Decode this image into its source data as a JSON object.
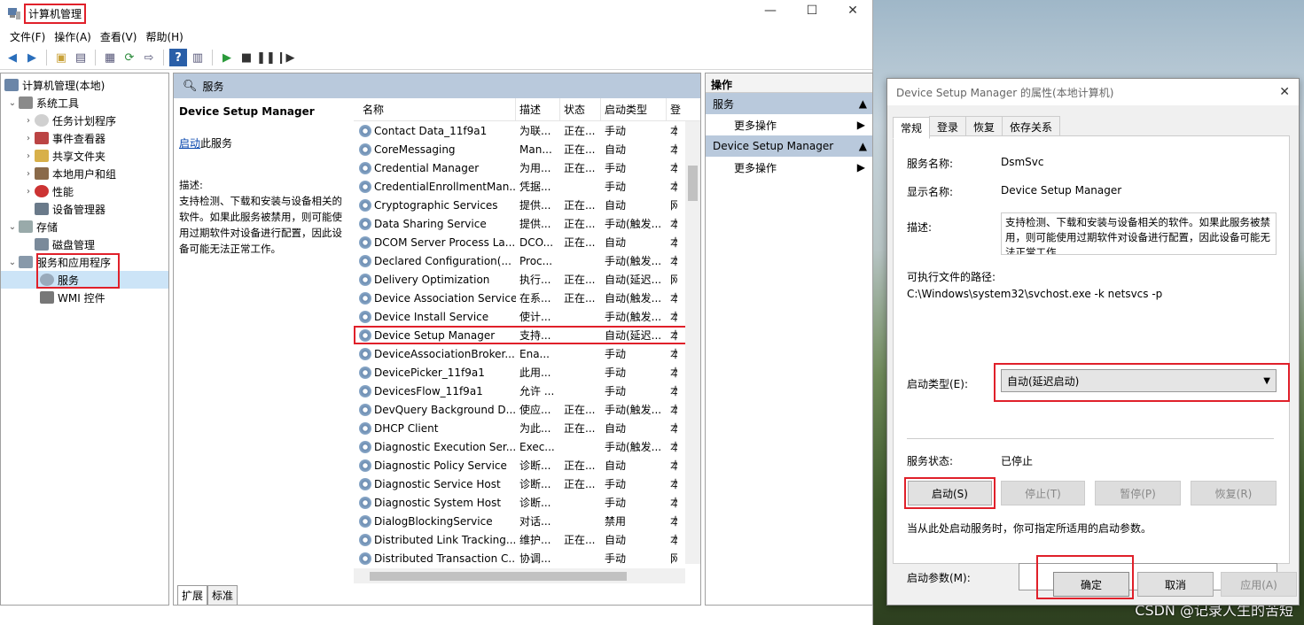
{
  "window": {
    "title": "计算机管理",
    "menu": [
      "文件(F)",
      "操作(A)",
      "查看(V)",
      "帮助(H)"
    ],
    "controls": {
      "minimize": "—",
      "maximize": "☐",
      "close": "✕"
    }
  },
  "tree": {
    "root": "计算机管理(本地)",
    "system_tools": "系统工具",
    "task_scheduler": "任务计划程序",
    "event_viewer": "事件查看器",
    "shared_folders": "共享文件夹",
    "local_users": "本地用户和组",
    "performance": "性能",
    "device_manager": "设备管理器",
    "storage": "存储",
    "disk_mgmt": "磁盘管理",
    "services_apps": "服务和应用程序",
    "services": "服务",
    "wmi": "WMI 控件"
  },
  "center": {
    "header": "服务",
    "selected_title": "Device Setup Manager",
    "start_link": "启动",
    "start_suffix": "此服务",
    "desc_label": "描述:",
    "desc_text": "支持检测、下载和安装与设备相关的软件。如果此服务被禁用，则可能使用过期软件对设备进行配置，因此设备可能无法正常工作。",
    "columns": {
      "name": "名称",
      "desc": "描述",
      "status": "状态",
      "startup": "启动类型",
      "logon": "登"
    },
    "rows": [
      {
        "name": "Contact Data_11f9a1",
        "desc": "为联...",
        "status": "正在...",
        "startup": "手动",
        "logon": "本"
      },
      {
        "name": "CoreMessaging",
        "desc": "Man...",
        "status": "正在...",
        "startup": "自动",
        "logon": "本"
      },
      {
        "name": "Credential Manager",
        "desc": "为用...",
        "status": "正在...",
        "startup": "手动",
        "logon": "本"
      },
      {
        "name": "CredentialEnrollmentMan...",
        "desc": "凭据...",
        "status": "",
        "startup": "手动",
        "logon": "本"
      },
      {
        "name": "Cryptographic Services",
        "desc": "提供...",
        "status": "正在...",
        "startup": "自动",
        "logon": "网"
      },
      {
        "name": "Data Sharing Service",
        "desc": "提供...",
        "status": "正在...",
        "startup": "手动(触发...",
        "logon": "本"
      },
      {
        "name": "DCOM Server Process La...",
        "desc": "DCO...",
        "status": "正在...",
        "startup": "自动",
        "logon": "本"
      },
      {
        "name": "Declared Configuration(...",
        "desc": "Proc...",
        "status": "",
        "startup": "手动(触发...",
        "logon": "本"
      },
      {
        "name": "Delivery Optimization",
        "desc": "执行...",
        "status": "正在...",
        "startup": "自动(延迟...",
        "logon": "网"
      },
      {
        "name": "Device Association Service",
        "desc": "在系...",
        "status": "正在...",
        "startup": "自动(触发...",
        "logon": "本"
      },
      {
        "name": "Device Install Service",
        "desc": "使计...",
        "status": "",
        "startup": "手动(触发...",
        "logon": "本"
      },
      {
        "name": "Device Setup Manager",
        "desc": "支持...",
        "status": "",
        "startup": "自动(延迟...",
        "logon": "本"
      },
      {
        "name": "DeviceAssociationBroker...",
        "desc": "Ena...",
        "status": "",
        "startup": "手动",
        "logon": "本"
      },
      {
        "name": "DevicePicker_11f9a1",
        "desc": "此用...",
        "status": "",
        "startup": "手动",
        "logon": "本"
      },
      {
        "name": "DevicesFlow_11f9a1",
        "desc": "允许 ...",
        "status": "",
        "startup": "手动",
        "logon": "本"
      },
      {
        "name": "DevQuery Background D...",
        "desc": "使应...",
        "status": "正在...",
        "startup": "手动(触发...",
        "logon": "本"
      },
      {
        "name": "DHCP Client",
        "desc": "为此...",
        "status": "正在...",
        "startup": "自动",
        "logon": "本"
      },
      {
        "name": "Diagnostic Execution Ser...",
        "desc": "Exec...",
        "status": "",
        "startup": "手动(触发...",
        "logon": "本"
      },
      {
        "name": "Diagnostic Policy Service",
        "desc": "诊断...",
        "status": "正在...",
        "startup": "自动",
        "logon": "本"
      },
      {
        "name": "Diagnostic Service Host",
        "desc": "诊断...",
        "status": "正在...",
        "startup": "手动",
        "logon": "本"
      },
      {
        "name": "Diagnostic System Host",
        "desc": "诊断...",
        "status": "",
        "startup": "手动",
        "logon": "本"
      },
      {
        "name": "DialogBlockingService",
        "desc": "对话...",
        "status": "",
        "startup": "禁用",
        "logon": "本"
      },
      {
        "name": "Distributed Link Tracking...",
        "desc": "维护...",
        "status": "正在...",
        "startup": "自动",
        "logon": "本"
      },
      {
        "name": "Distributed Transaction C...",
        "desc": "协调...",
        "status": "",
        "startup": "手动",
        "logon": "网"
      }
    ],
    "tabs": [
      "扩展",
      "标准"
    ]
  },
  "actions": {
    "title": "操作",
    "section1": "服务",
    "more1": "更多操作",
    "section2": "Device Setup Manager",
    "more2": "更多操作"
  },
  "dialog": {
    "title": "Device Setup Manager 的属性(本地计算机)",
    "tabs": [
      "常规",
      "登录",
      "恢复",
      "依存关系"
    ],
    "service_name_label": "服务名称:",
    "service_name": "DsmSvc",
    "display_name_label": "显示名称:",
    "display_name": "Device Setup Manager",
    "desc_label": "描述:",
    "desc": "支持检测、下载和安装与设备相关的软件。如果此服务被禁用，则可能使用过期软件对设备进行配置，因此设备可能无法正常工作",
    "path_label": "可执行文件的路径:",
    "path": "C:\\Windows\\system32\\svchost.exe -k netsvcs -p",
    "startup_label": "启动类型(E):",
    "startup_value": "自动(延迟启动)",
    "status_label": "服务状态:",
    "status_value": "已停止",
    "btn_start": "启动(S)",
    "btn_stop": "停止(T)",
    "btn_pause": "暂停(P)",
    "btn_resume": "恢复(R)",
    "hint": "当从此处启动服务时，你可指定所适用的启动参数。",
    "params_label": "启动参数(M):",
    "btn_ok": "确定",
    "btn_cancel": "取消",
    "btn_apply": "应用(A)"
  },
  "watermark": "CSDN @记录人生的苦短"
}
